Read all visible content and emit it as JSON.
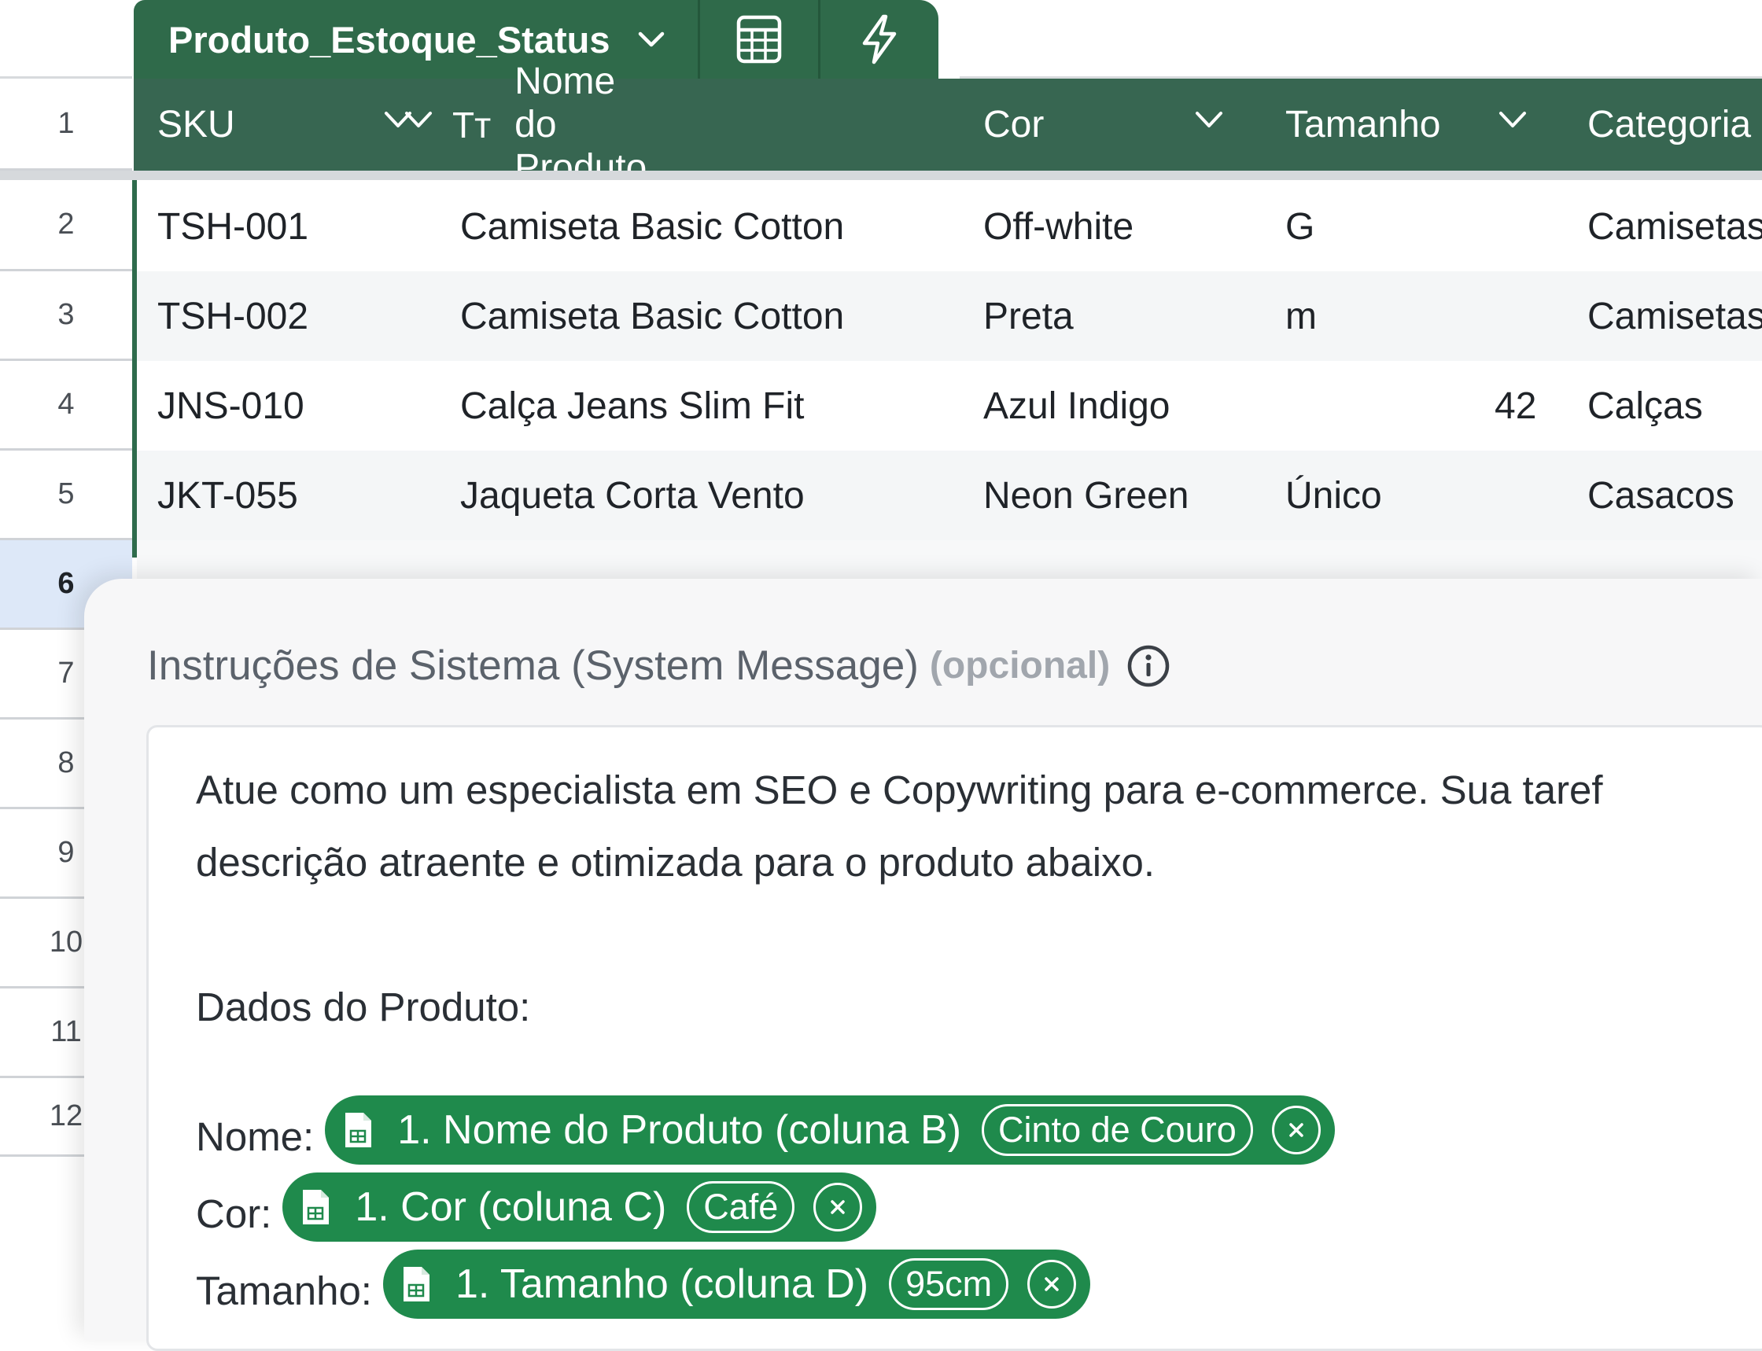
{
  "tab": {
    "name": "Produto_Estoque_Status"
  },
  "columns": [
    {
      "label": "SKU"
    },
    {
      "label": "Nome do Produto",
      "type_icon": "Tт"
    },
    {
      "label": "Cor"
    },
    {
      "label": "Tamanho"
    },
    {
      "label": "Categoria"
    }
  ],
  "row_numbers": [
    "1",
    "2",
    "3",
    "4",
    "5",
    "6",
    "7",
    "8",
    "9",
    "10",
    "11",
    "12"
  ],
  "selected_row": "6",
  "rows": [
    {
      "sku": "TSH-001",
      "nome": "Camiseta Basic Cotton",
      "cor": "Off-white",
      "tamanho": "G",
      "categoria": "Camisetas"
    },
    {
      "sku": "TSH-002",
      "nome": "Camiseta Basic Cotton",
      "cor": "Preta",
      "tamanho": "m",
      "categoria": "Camisetas"
    },
    {
      "sku": "JNS-010",
      "nome": "Calça Jeans Slim Fit",
      "cor": "Azul Indigo",
      "tamanho": "42",
      "categoria": "Calças"
    },
    {
      "sku": "JKT-055",
      "nome": "Jaqueta Corta Vento",
      "cor": "Neon Green",
      "tamanho": "Único",
      "categoria": "Casacos"
    }
  ],
  "panel": {
    "title": "Instruções de Sistema (System Message)",
    "optional": "(opcional)",
    "paragraph_line1": "Atue como um especialista em SEO e Copywriting para e-commerce. Sua taref",
    "paragraph_line2": "descrição atraente e otimizada para o produto abaixo.",
    "section_heading": "Dados do Produto:",
    "fields": [
      {
        "label": "Nome:",
        "chip": "1. Nome do Produto (coluna B)",
        "value": "Cinto de Couro"
      },
      {
        "label": "Cor:",
        "chip": "1. Cor (coluna C)",
        "value": "Café"
      },
      {
        "label": "Tamanho:",
        "chip": "1. Tamanho (coluna D)",
        "value": "95cm"
      }
    ]
  },
  "colors": {
    "header_green": "#376651",
    "tab_green": "#2f6a4a",
    "chip_green": "#1f8a4c",
    "selected_row": "#dde8f8"
  },
  "icons": {
    "tab_dropdown": "chevron-down-icon",
    "tab_calc": "calculator-icon",
    "tab_automation": "lightning-icon",
    "column_dropdown": "chevron-down-icon",
    "info": "info-icon",
    "sheet": "sheet-icon",
    "remove": "close-icon"
  }
}
